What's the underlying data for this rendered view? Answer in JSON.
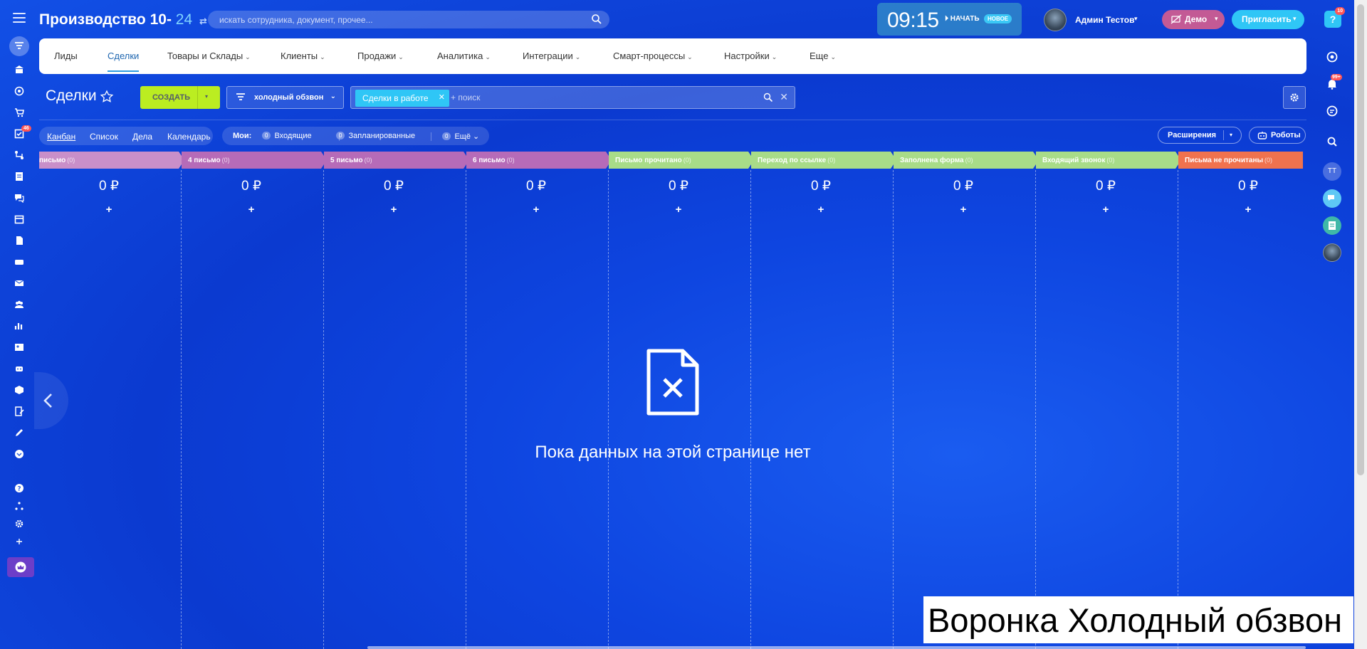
{
  "header": {
    "portal_name": "Производство 10-",
    "portal_num": "24",
    "search_placeholder": "искать сотрудника, документ, прочее...",
    "time": "09:15",
    "start_label": "НАЧАТЬ",
    "new_badge": "НОВОЕ",
    "user_name": "Админ Тестов",
    "demo_label": "Демо",
    "invite_label": "Пригласить",
    "help_label": "?",
    "help_count": "10"
  },
  "sidebar": {
    "badge_count": "46"
  },
  "nav": {
    "tabs": [
      {
        "label": "Лиды"
      },
      {
        "label": "Сделки"
      },
      {
        "label": "Товары и Склады"
      },
      {
        "label": "Клиенты"
      },
      {
        "label": "Продажи"
      },
      {
        "label": "Аналитика"
      },
      {
        "label": "Интеграции"
      },
      {
        "label": "Смарт-процессы"
      },
      {
        "label": "Настройки"
      },
      {
        "label": "Еще"
      }
    ]
  },
  "page": {
    "title": "Сделки",
    "create_label": "СОЗДАТЬ",
    "funnel_label": "холодный обзвон",
    "filter_chip": "Сделки в работе",
    "filter_placeholder": "+ поиск"
  },
  "views": [
    "Канбан",
    "Список",
    "Дела",
    "Календарь"
  ],
  "counters": {
    "mine_label": "Мои:",
    "incoming_label": "Входящие",
    "incoming_count": "0",
    "planned_label": "Запланированные",
    "planned_count": "0",
    "more_label": "Ещё",
    "more_count": "0"
  },
  "toolbar": {
    "extensions_label": "Расширения",
    "robots_label": "Роботы"
  },
  "kanban": {
    "columns": [
      {
        "name": "письмо",
        "count": "(0)",
        "sum": "0 ₽",
        "color": "#c98fc9"
      },
      {
        "name": "4 письмо",
        "count": "(0)",
        "sum": "0 ₽",
        "color": "#b66bb8"
      },
      {
        "name": "5 письмо",
        "count": "(0)",
        "sum": "0 ₽",
        "color": "#b66bb8"
      },
      {
        "name": "6 письмо",
        "count": "(0)",
        "sum": "0 ₽",
        "color": "#b66bb8"
      },
      {
        "name": "Письмо прочитано",
        "count": "(0)",
        "sum": "0 ₽",
        "color": "#a8dc88"
      },
      {
        "name": "Переход по ссылке",
        "count": "(0)",
        "sum": "0 ₽",
        "color": "#a8dc88"
      },
      {
        "name": "Заполнена форма",
        "count": "(0)",
        "sum": "0 ₽",
        "color": "#a8dc88"
      },
      {
        "name": "Входящий звонок",
        "count": "(0)",
        "sum": "0 ₽",
        "color": "#a8dc88"
      },
      {
        "name": "Письма не прочитаны",
        "count": "(0)",
        "sum": "0 ₽",
        "color": "#f0724e"
      }
    ],
    "empty_message": "Пока данных на этой странице нет"
  },
  "right_sidebar": {
    "notif_count": "99+",
    "user_initials": "ТТ"
  },
  "caption": "Воронка Холодный обзвон"
}
